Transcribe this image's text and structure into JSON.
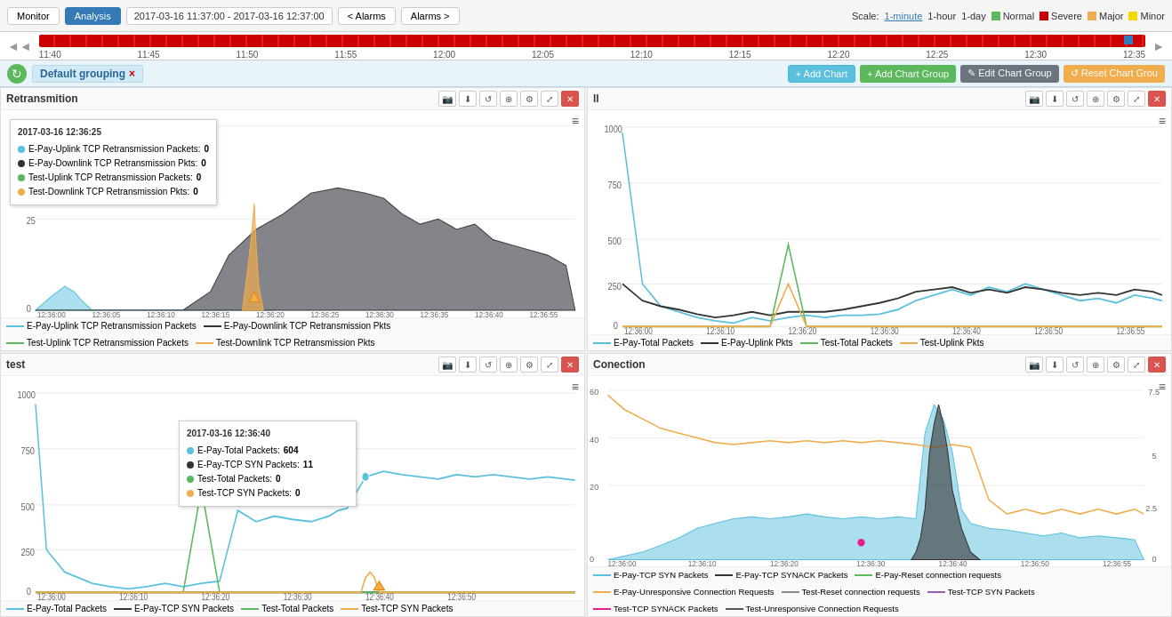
{
  "topbar": {
    "monitor_label": "Monitor",
    "analysis_label": "Analysis",
    "time_range": "2017-03-16 11:37:00 - 2017-03-16 12:37:00",
    "alarm_prev": "< Alarms",
    "alarm_next": "Alarms >",
    "scale_label": "Scale:",
    "scale_1min": "1-minute",
    "scale_1hr": "1-hour",
    "scale_1day": "1-day",
    "legend": [
      {
        "label": "Normal",
        "color": "#5cb85c"
      },
      {
        "label": "Severe",
        "color": "#cc0000"
      },
      {
        "label": "Major",
        "color": "#f0ad4e"
      },
      {
        "label": "Minor",
        "color": "#f5d800"
      }
    ]
  },
  "timeline": {
    "labels": [
      "11:40",
      "11:45",
      "11:50",
      "11:55",
      "12:00",
      "12:05",
      "12:10",
      "12:15",
      "12:20",
      "12:25",
      "12:30",
      "12:35"
    ]
  },
  "groupbar": {
    "group_name": "Default grouping",
    "close_icon": "×",
    "refresh_icon": "↻",
    "add_chart": "+ Add Chart",
    "add_chart_group": "+ Add Chart Group",
    "edit_chart_group": "✎ Edit Chart Group",
    "reset_chart_group": "↺ Reset Chart Grou"
  },
  "charts": [
    {
      "id": "retransmition",
      "title": "Retransmition",
      "y_max": 50,
      "tooltip": {
        "time": "2017-03-16 12:36:25",
        "rows": [
          {
            "label": "E-Pay-Uplink TCP Retransmission Packets:",
            "value": "0",
            "color": "#5bc0de"
          },
          {
            "label": "E-Pay-Downlink TCP Retransmission Pkts:",
            "value": "0",
            "color": "#333"
          },
          {
            "label": "Test-Uplink TCP Retransmission Packets:",
            "value": "0",
            "color": "#5cb85c"
          },
          {
            "label": "Test-Downlink TCP Retransmission Pkts:",
            "value": "0",
            "color": "#f0ad4e"
          }
        ]
      },
      "legend": [
        {
          "label": "E-Pay-Uplink TCP Retransmission Packets",
          "color": "#5bc0de",
          "type": "area"
        },
        {
          "label": "E-Pay-Downlink TCP Retransmission Pkts",
          "color": "#333",
          "type": "line"
        },
        {
          "label": "Test-Uplink TCP Retransmission Packets",
          "color": "#5cb85c",
          "type": "line"
        },
        {
          "label": "Test-Downlink TCP Retransmission Pkts",
          "color": "#f0ad4e",
          "type": "line"
        }
      ]
    },
    {
      "id": "ll",
      "title": "ll",
      "y_max": 1000,
      "legend": [
        {
          "label": "E-Pay-Total Packets",
          "color": "#5bc0de",
          "type": "line"
        },
        {
          "label": "E-Pay-Uplink Pkts",
          "color": "#333",
          "type": "line"
        },
        {
          "label": "Test-Total Packets",
          "color": "#5cb85c",
          "type": "line"
        },
        {
          "label": "Test-Uplink Pkts",
          "color": "#f0ad4e",
          "type": "line"
        }
      ]
    },
    {
      "id": "test",
      "title": "test",
      "y_max": 1000,
      "tooltip": {
        "time": "2017-03-16 12:36:40",
        "rows": [
          {
            "label": "E-Pay-Total Packets:",
            "value": "604",
            "color": "#5bc0de"
          },
          {
            "label": "E-Pay-TCP SYN Packets:",
            "value": "11",
            "color": "#333"
          },
          {
            "label": "Test-Total Packets:",
            "value": "0",
            "color": "#5cb85c"
          },
          {
            "label": "Test-TCP SYN Packets:",
            "value": "0",
            "color": "#f0ad4e"
          }
        ]
      },
      "legend": [
        {
          "label": "E-Pay-Total Packets",
          "color": "#5bc0de",
          "type": "line"
        },
        {
          "label": "E-Pay-TCP SYN Packets",
          "color": "#333",
          "type": "line"
        },
        {
          "label": "Test-Total Packets",
          "color": "#5cb85c",
          "type": "line"
        },
        {
          "label": "Test-TCP SYN Packets",
          "color": "#f0ad4e",
          "type": "line"
        }
      ]
    },
    {
      "id": "connection",
      "title": "Conection",
      "y_max": 60,
      "y_max2": 7.5,
      "legend": [
        {
          "label": "E-Pay-TCP SYN Packets",
          "color": "#5bc0de",
          "type": "area"
        },
        {
          "label": "E-Pay-TCP SYNACK Packets",
          "color": "#333",
          "type": "area"
        },
        {
          "label": "E-Pay-Reset connection requests",
          "color": "#5cb85c",
          "type": "line"
        },
        {
          "label": "E-Pay-Unresponsive Connection Requests",
          "color": "#f0ad4e",
          "type": "line"
        },
        {
          "label": "Test-Reset connection requests",
          "color": "#888",
          "type": "line"
        },
        {
          "label": "Test-TCP SYN Packets",
          "color": "#9b59b6",
          "type": "line"
        },
        {
          "label": "Test-TCP SYNACK Packets",
          "color": "#e91e8c",
          "type": "line"
        },
        {
          "label": "Test-Unresponsive Connection Requests",
          "color": "#555",
          "type": "line"
        }
      ]
    }
  ]
}
